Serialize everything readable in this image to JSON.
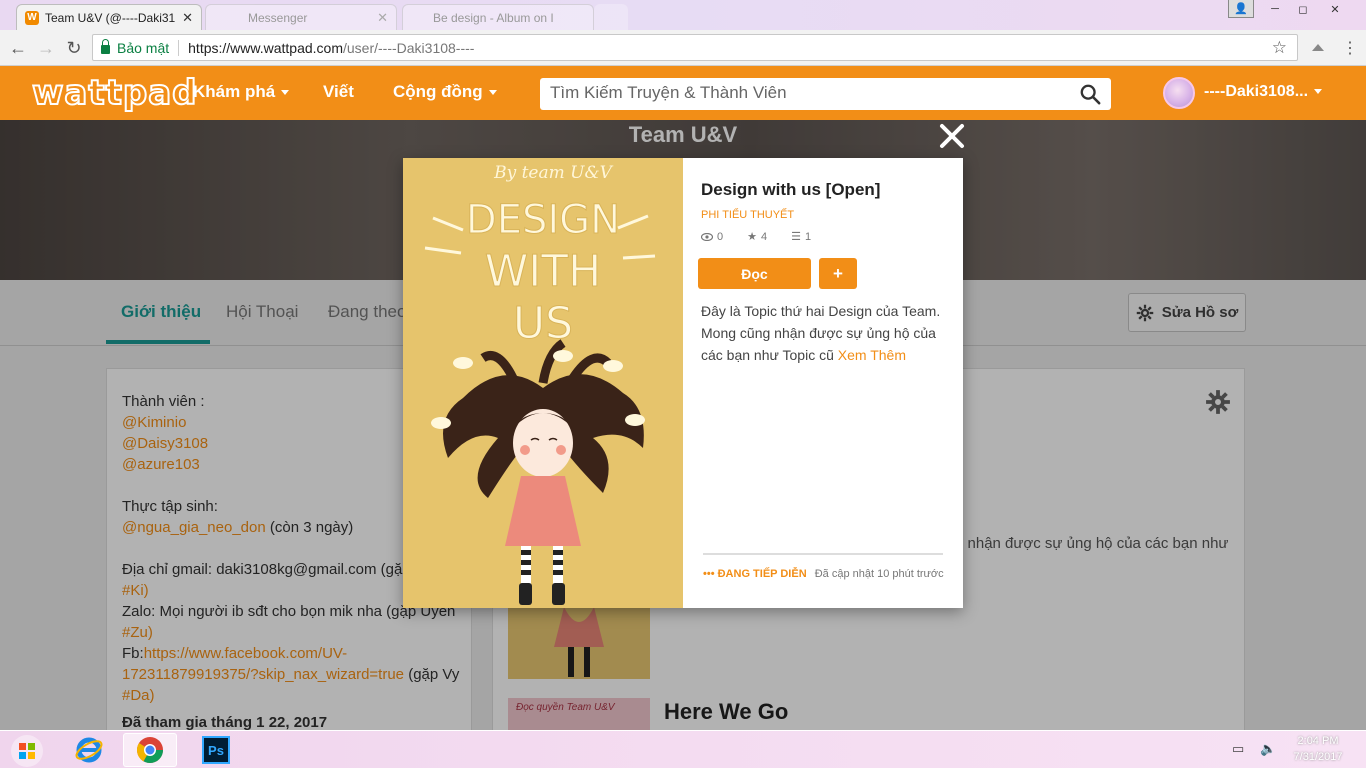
{
  "browser": {
    "tabs": [
      {
        "title": "Team U&V (@----Daki31",
        "favicon": "W",
        "active": true
      },
      {
        "title": "Messenger",
        "active": false
      },
      {
        "title": "Be design - Album on I",
        "active": false
      }
    ],
    "security_label": "Bảo mật",
    "url_host": "https://www.wattpad.com",
    "url_path": "/user/----Daki3108----"
  },
  "header": {
    "logo": "wattpad",
    "nav": {
      "discover": "Khám phá",
      "write": "Viết",
      "community": "Cộng đồng"
    },
    "search_placeholder": "Tìm Kiếm Truyện & Thành Viên",
    "username": "----Daki3108..."
  },
  "profile": {
    "name": "Team U&V",
    "tabs": {
      "about": "Giới thiệu",
      "conversations": "Hội Thoại",
      "following": "Đang theo"
    },
    "edit_label": "Sửa Hồ sơ",
    "about": {
      "members_label": "Thành viên :",
      "members": [
        "@Kiminio",
        "@Daisy3108",
        "@azure103"
      ],
      "interns_label": "Thực tập sinh:",
      "intern_name": "@ngua_gia_neo_don",
      "intern_note": " (còn 3 ngày)",
      "gmail_line": "Địa chỉ gmail: daki3108kg@gmail.com (gặp",
      "gmail_tag": "#Ki)",
      "zalo_line": "Zalo: Mọi người ib sđt cho bọn mik nha (gặp Uyên",
      "zalo_tag": "#Zu)",
      "fb_label": "Fb:",
      "fb_link_1": "https://www.facebook.com/UV-",
      "fb_link_2": "172311879919375/?skip_nax_wizard=true",
      "fb_note": " (gặp Vy",
      "fb_tag": "#Da)",
      "joined": "Đã tham gia  tháng 1 22, 2017"
    },
    "behind_text": "g nhận được sự ủng hộ của các bạn như",
    "thumb2_text": "Đọc quyền Team U&V",
    "second_story_title": "Here We Go"
  },
  "modal": {
    "cover_text": {
      "by": "By team U&V",
      "main": "DESIGN WITH US"
    },
    "title": "Design with us [Open]",
    "category": "Phi Tiểu Thuyết",
    "reads": "0",
    "votes": "4",
    "parts": "1",
    "read_button": "Đọc",
    "add_button": "+",
    "description": "Đây là Topic thứ hai Design của Team. Mong cũng nhận được sự ủng hộ của các bạn như Topic cũ ",
    "more_link": "Xem Thêm",
    "status": "••• ĐANG TIẾP DIỄN",
    "updated": "Đã cập nhật 10 phút trước"
  },
  "taskbar": {
    "time": "2:04 PM",
    "date": "7/31/2017",
    "apps": [
      "windows-start",
      "internet-explorer",
      "chrome",
      "photoshop"
    ],
    "ps_label": "Ps"
  },
  "colors": {
    "brand": "#f28e17",
    "teal": "#1a9b95",
    "cover": "#e6c46c"
  }
}
